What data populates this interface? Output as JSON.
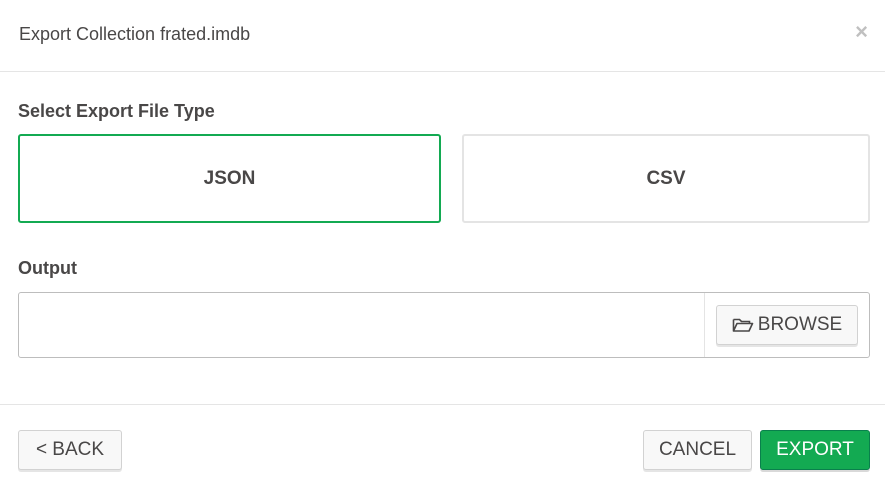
{
  "modal": {
    "title": "Export Collection frated.imdb",
    "close_glyph": "×"
  },
  "file_type": {
    "label": "Select Export File Type",
    "options": [
      {
        "label": "JSON",
        "selected": true
      },
      {
        "label": "CSV",
        "selected": false
      }
    ]
  },
  "output": {
    "label": "Output",
    "value": "",
    "placeholder": "",
    "browse_label": "BROWSE",
    "browse_icon": "folder-open-icon"
  },
  "footer": {
    "back_label": "< BACK",
    "cancel_label": "CANCEL",
    "export_label": "EXPORT"
  },
  "colors": {
    "accent": "#13aa52",
    "text": "#494747",
    "border": "#e4e4e4"
  }
}
